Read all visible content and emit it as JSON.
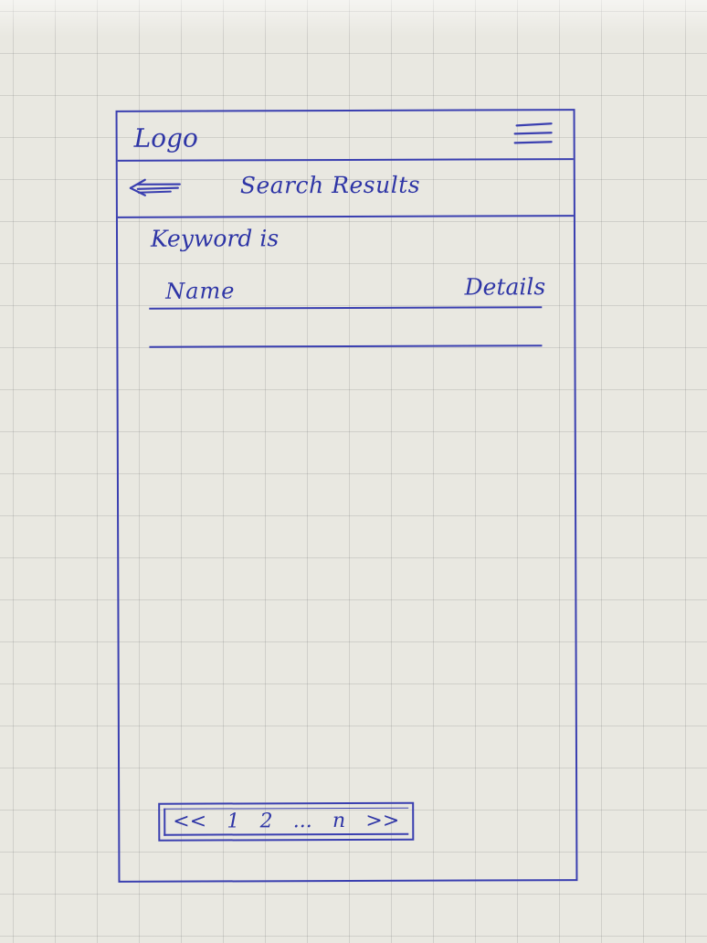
{
  "header": {
    "logo": "Logo",
    "menu_icon": "hamburger-menu-icon"
  },
  "nav": {
    "back_icon": "back-arrow-icon",
    "title": "Search Results"
  },
  "search": {
    "keyword_label": "Keyword is"
  },
  "results_table": {
    "columns": [
      "Name",
      "Details"
    ],
    "rows": []
  },
  "pagination": {
    "first": "<<",
    "pages": [
      "1",
      "2",
      "...",
      "n"
    ],
    "last": ">>"
  },
  "colors": {
    "ink": "#2e35a6",
    "paper": "#e9e8e1"
  }
}
